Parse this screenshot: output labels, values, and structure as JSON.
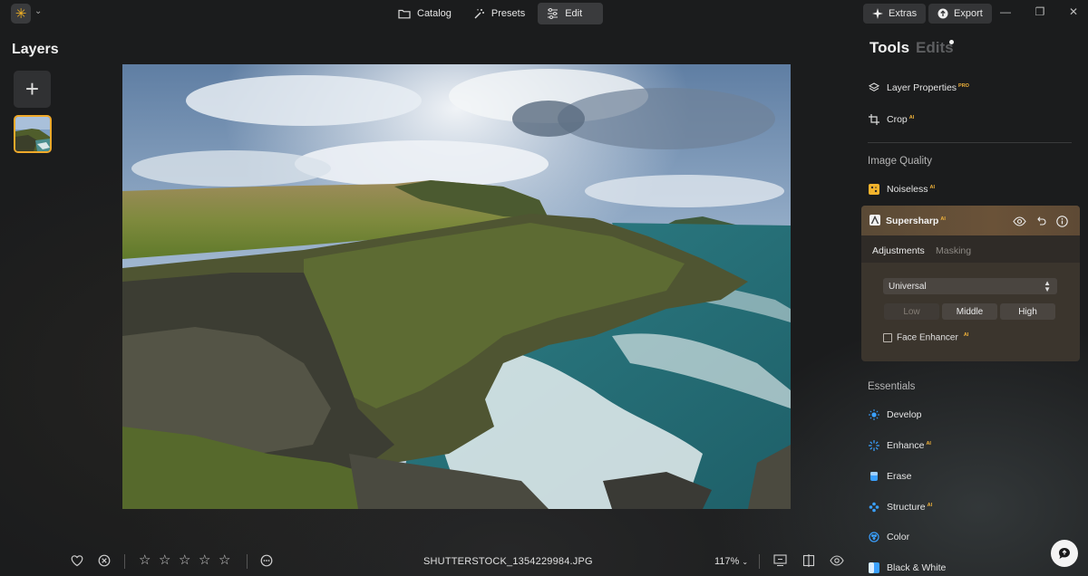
{
  "topbar": {
    "nav": [
      {
        "label": "Catalog",
        "icon": "folder-icon"
      },
      {
        "label": "Presets",
        "icon": "magic-wand-icon"
      },
      {
        "label": "Edit",
        "icon": "sliders-icon",
        "active": true
      }
    ],
    "extras_label": "Extras",
    "export_label": "Export"
  },
  "left_panel": {
    "title": "Layers"
  },
  "bottom_bar": {
    "filename": "SHUTTERSTOCK_1354229984.JPG",
    "zoom": "117%",
    "rating_max": 5,
    "rating": 0
  },
  "right_panel": {
    "tabs": {
      "tools": "Tools",
      "edits": "Edits"
    },
    "top_items": [
      {
        "label": "Layer Properties",
        "badge": "PRO",
        "icon": "layers-icon"
      },
      {
        "label": "Crop",
        "badge": "AI",
        "icon": "crop-icon"
      }
    ],
    "image_quality_title": "Image Quality",
    "noiseless": {
      "label": "Noiseless",
      "badge": "AI"
    },
    "supersharp": {
      "label": "Supersharp",
      "badge": "AI",
      "subtabs": [
        "Adjustments",
        "Masking"
      ],
      "mode": "Universal",
      "levels": [
        "Low",
        "Middle",
        "High"
      ],
      "face_enhancer": {
        "label": "Face Enhancer",
        "badge": "AI",
        "checked": false
      }
    },
    "essentials_title": "Essentials",
    "essentials": [
      {
        "label": "Develop",
        "badge": "",
        "icon": "sun-icon"
      },
      {
        "label": "Enhance",
        "badge": "AI",
        "icon": "sparkle-icon"
      },
      {
        "label": "Erase",
        "badge": "",
        "icon": "eraser-icon"
      },
      {
        "label": "Structure",
        "badge": "AI",
        "icon": "structure-icon"
      },
      {
        "label": "Color",
        "badge": "",
        "icon": "color-icon"
      },
      {
        "label": "Black & White",
        "badge": "",
        "icon": "bw-icon"
      }
    ]
  },
  "colors": {
    "accent": "#f0a92a",
    "tool_icon_blue": "#3aa0ff",
    "badge": "#f0b23a"
  }
}
